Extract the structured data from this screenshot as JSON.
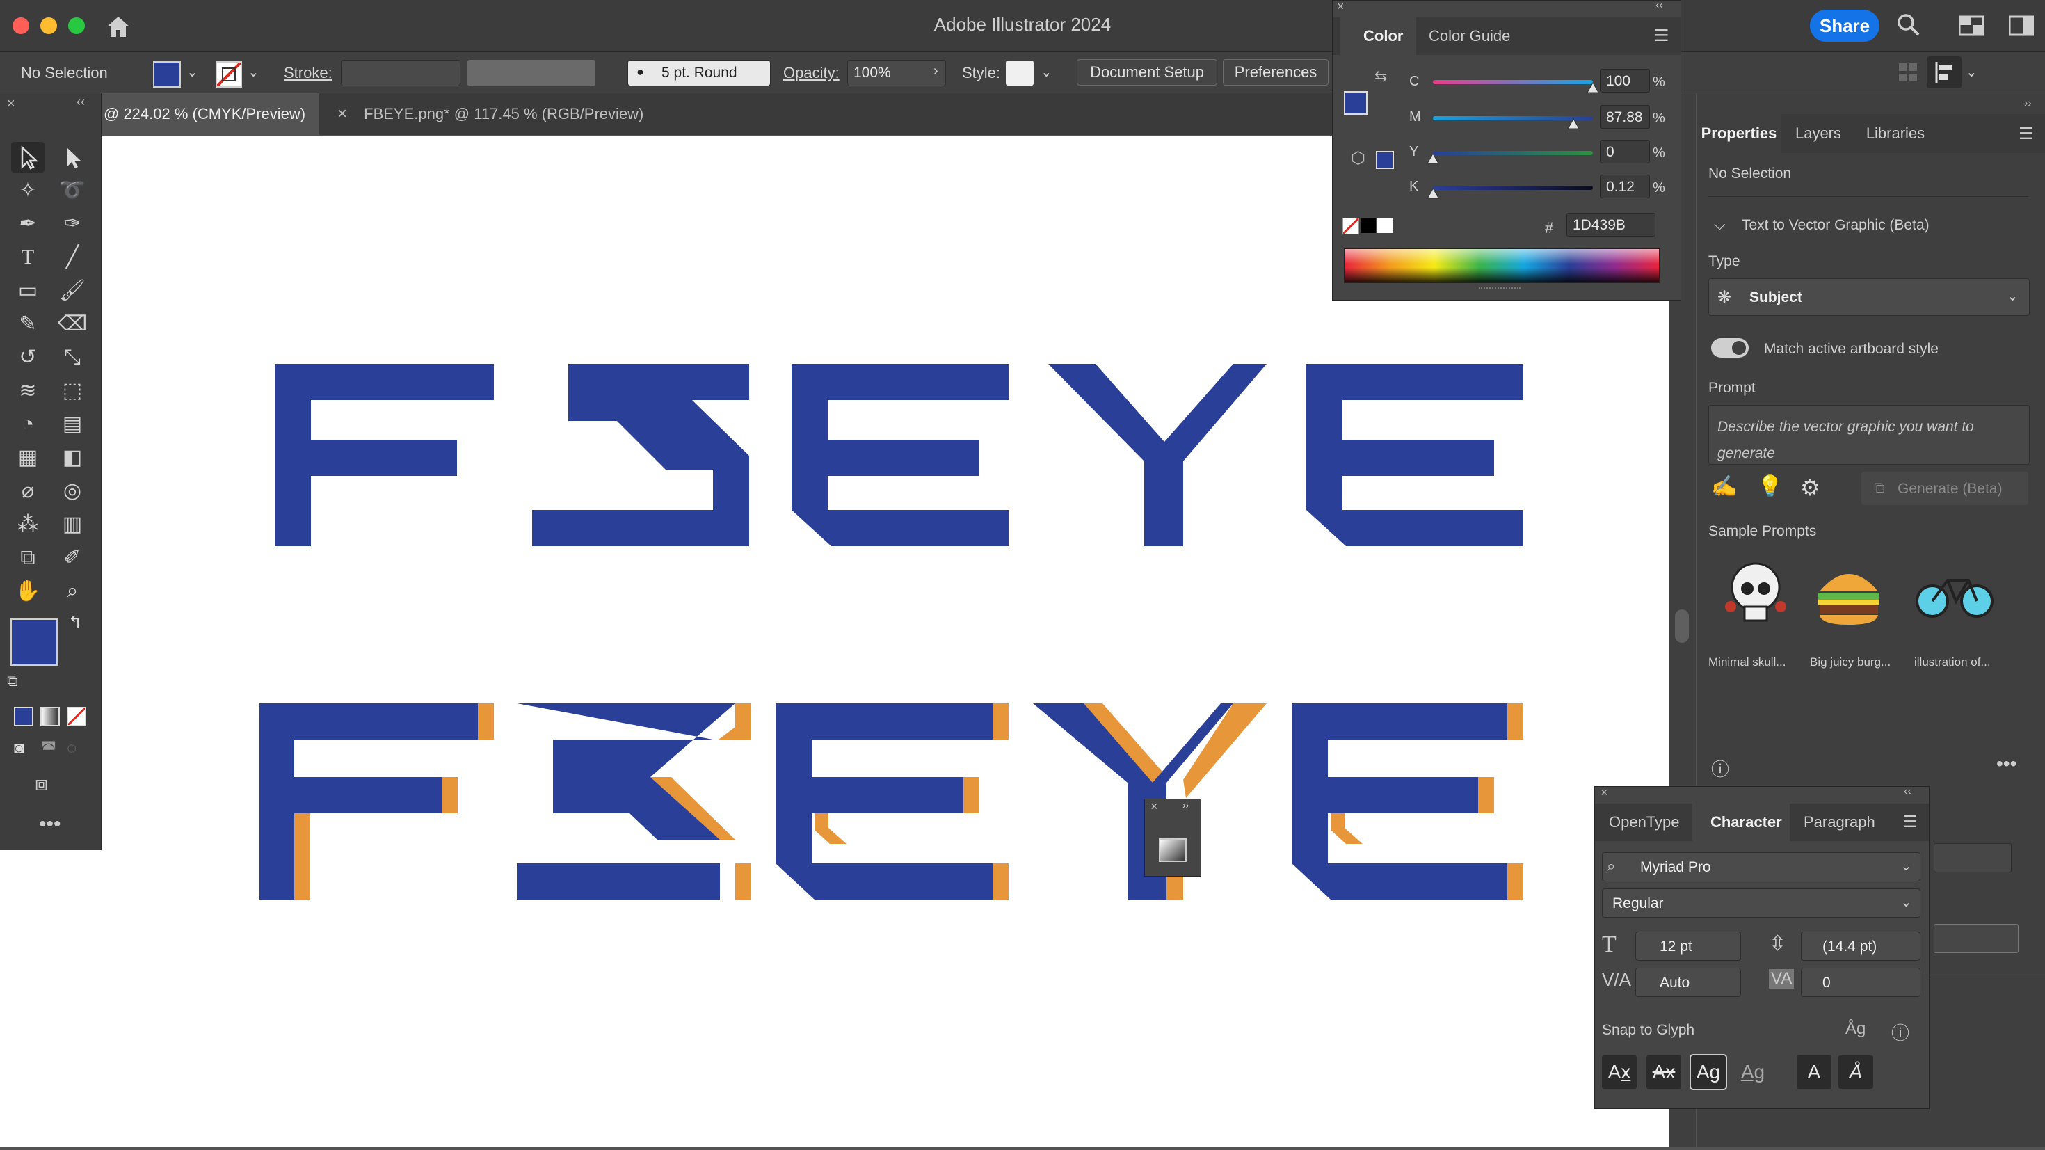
{
  "app": {
    "title": "Adobe Illustrator 2024",
    "share_label": "Share"
  },
  "control_bar": {
    "selection": "No Selection",
    "stroke_label": "Stroke:",
    "brush": "5 pt. Round",
    "opacity_label": "Opacity:",
    "opacity_value": "100%",
    "style_label": "Style:",
    "document_setup": "Document Setup",
    "preferences": "Preferences"
  },
  "tabs": [
    {
      "label": "@ 224.02 % (CMYK/Preview)"
    },
    {
      "label": "FBEYE.png* @ 117.45 % (RGB/Preview)",
      "close": "×"
    }
  ],
  "artwork": {
    "top_text": "FBEYE",
    "bottom_text": "FBEYE",
    "fill": "#2a3f97",
    "shadow": "#e8963a"
  },
  "color_panel": {
    "tabs": [
      "Color",
      "Color Guide"
    ],
    "sliders": [
      {
        "label": "C",
        "value": "100",
        "pct": 100
      },
      {
        "label": "M",
        "value": "87.88",
        "pct": 87.88
      },
      {
        "label": "Y",
        "value": "0",
        "pct": 0
      },
      {
        "label": "K",
        "value": "0.12",
        "pct": 0.12
      }
    ],
    "unit": "%",
    "hash": "#",
    "hex": "1D439B"
  },
  "properties": {
    "tabs": [
      "Properties",
      "Layers",
      "Libraries"
    ],
    "selection": "No Selection",
    "section": "Text to Vector Graphic (Beta)",
    "type_label": "Type",
    "type_value": "Subject",
    "toggle_label": "Match active artboard style",
    "prompt_label": "Prompt",
    "prompt_placeholder": "Describe the vector graphic you want to generate",
    "generate": "Generate (Beta)",
    "sample_label": "Sample Prompts",
    "samples": [
      "Minimal skull...",
      "Big juicy burg...",
      "illustration of..."
    ]
  },
  "character_panel": {
    "tabs": [
      "OpenType",
      "Character",
      "Paragraph"
    ],
    "font": "Myriad Pro",
    "style": "Regular",
    "size": "12 pt",
    "leading": "(14.4 pt)",
    "kerning": "Auto",
    "tracking": "0",
    "snap_label": "Snap to Glyph"
  }
}
